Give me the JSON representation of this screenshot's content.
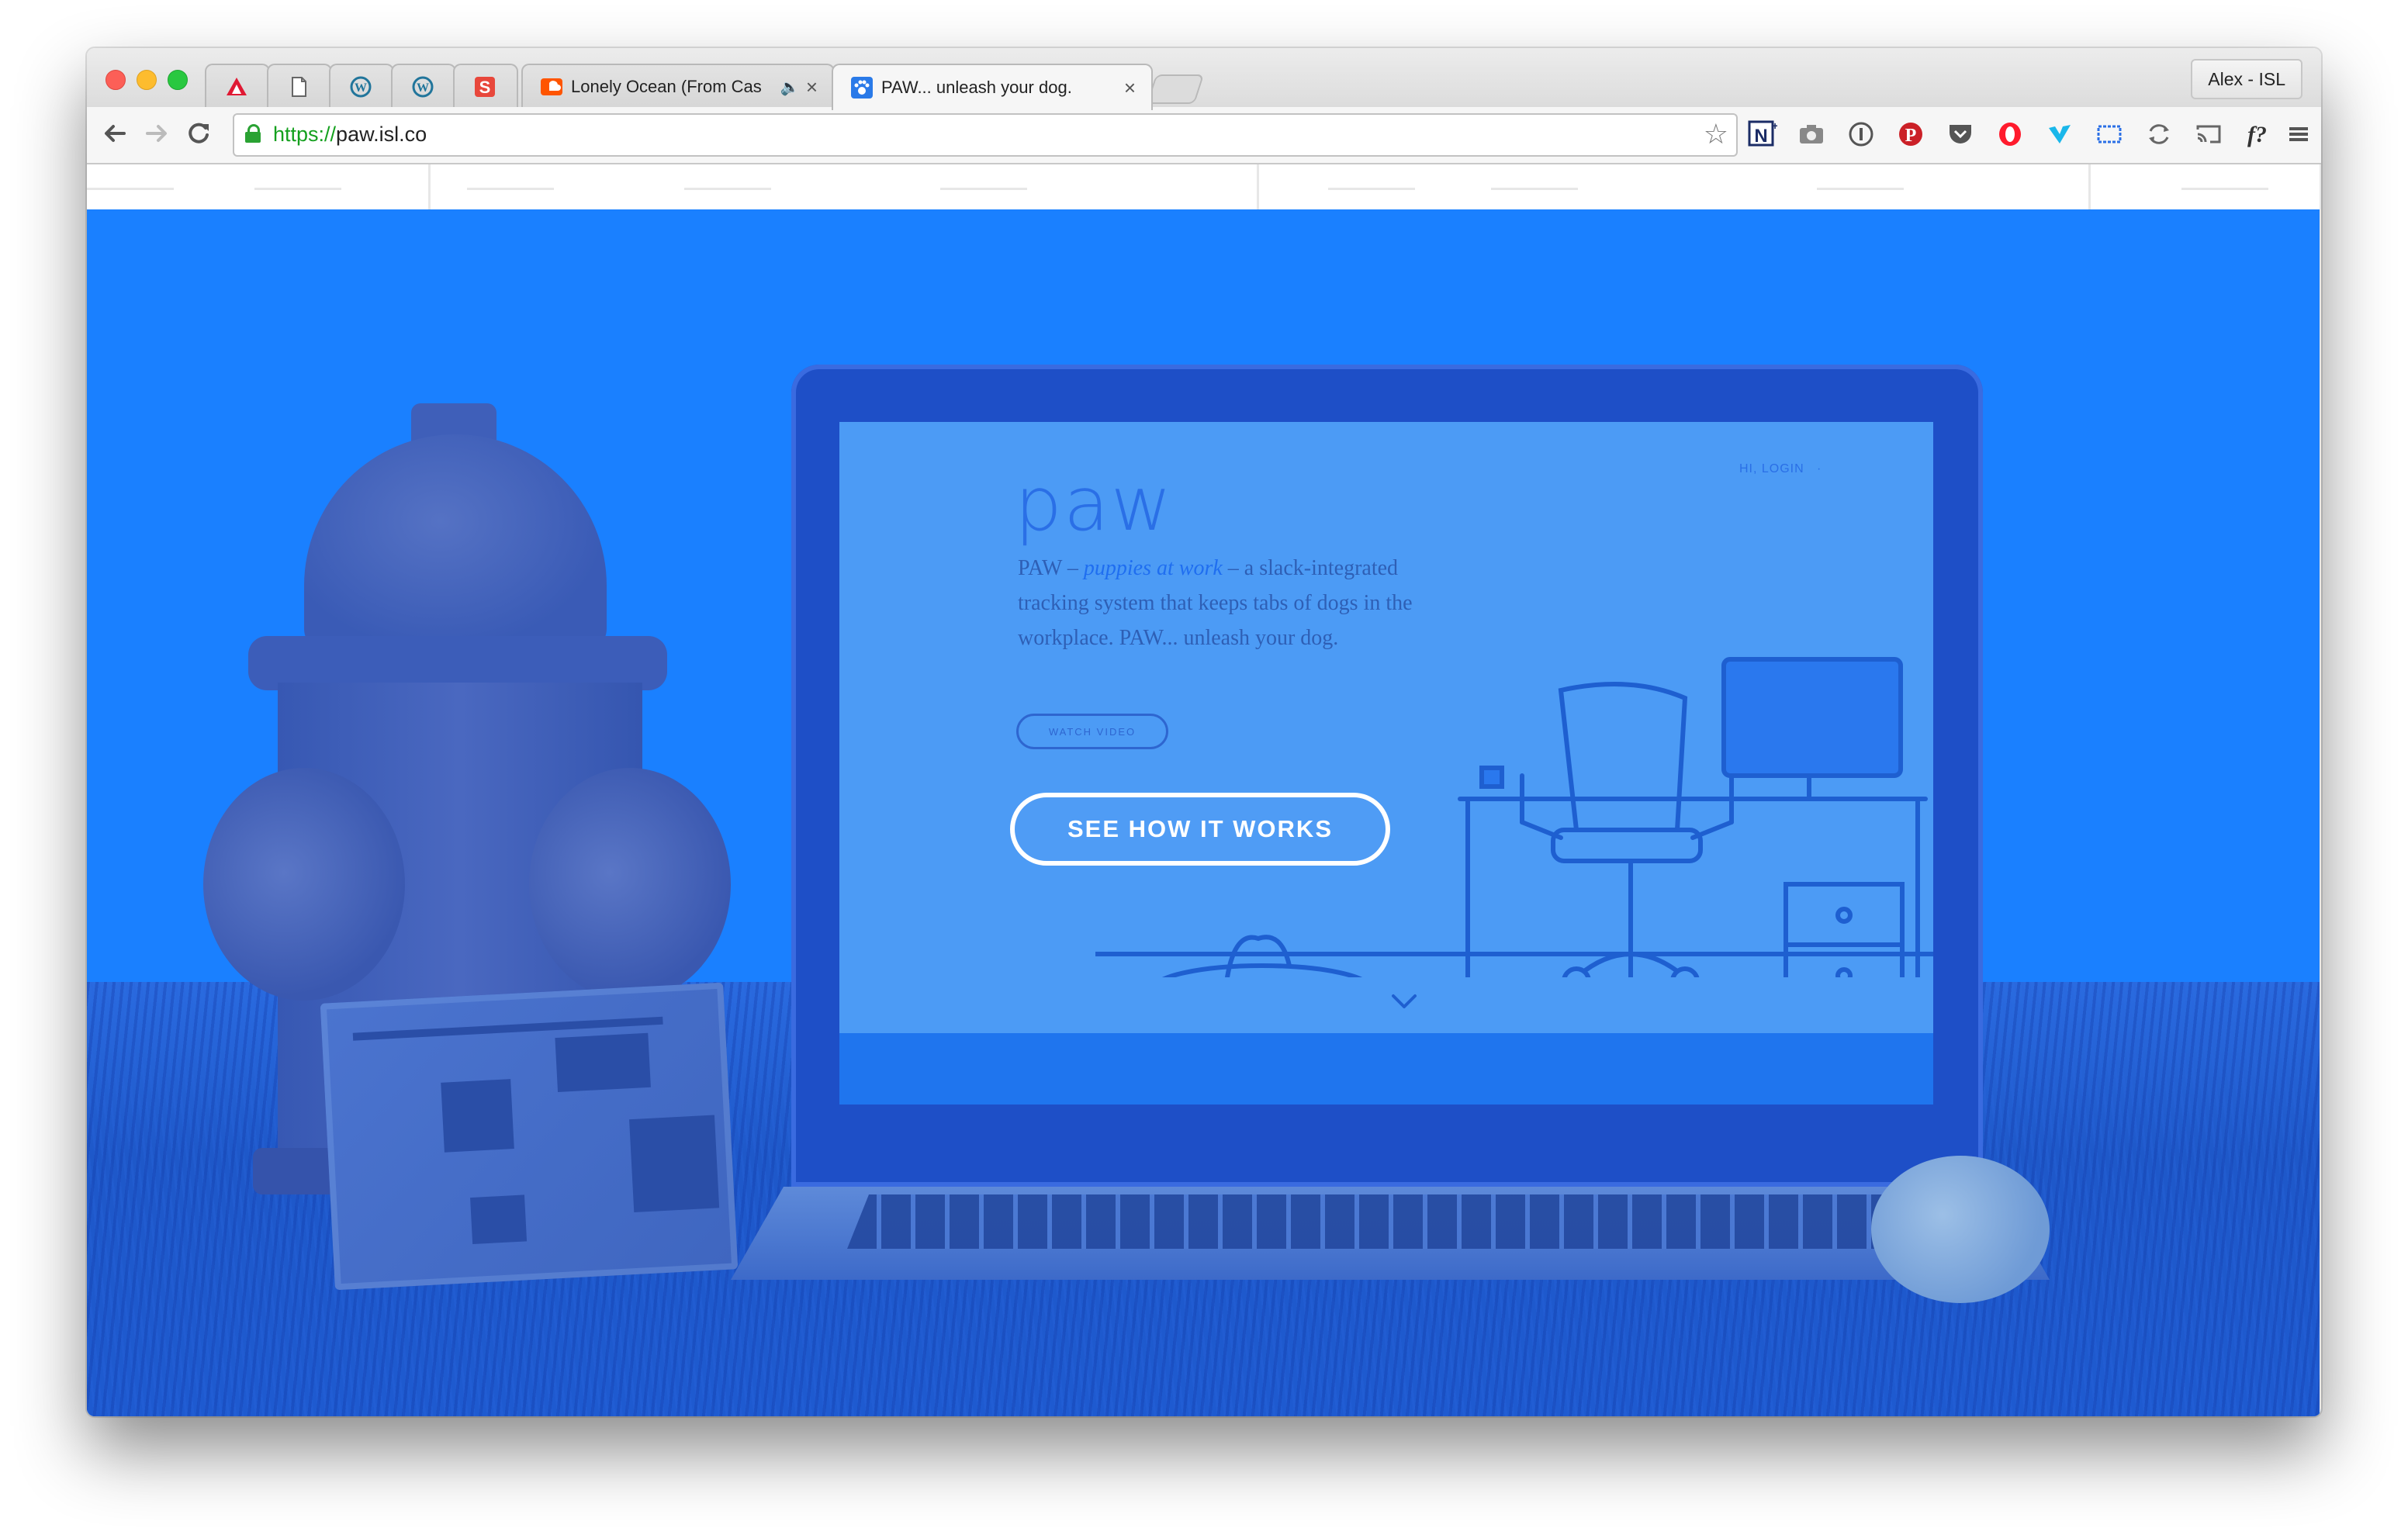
{
  "browser": {
    "tabs": [
      {
        "title": "",
        "favicon": "delta-icon",
        "favicon_color": "#e01933"
      },
      {
        "title": "",
        "favicon": "blank-page-icon",
        "favicon_color": "#777777"
      },
      {
        "title": "",
        "favicon": "wordpress-icon",
        "favicon_color": "#21759b"
      },
      {
        "title": "",
        "favicon": "wordpress-icon",
        "favicon_color": "#21759b"
      },
      {
        "title": "",
        "favicon": "s-app-icon",
        "favicon_color": "#e8473b"
      },
      {
        "title": "Lonely Ocean (From Cas",
        "favicon": "soundcloud-icon",
        "favicon_color": "#ff5500",
        "audio": true
      },
      {
        "title": "PAW... unleash your dog.",
        "favicon": "paw-icon",
        "favicon_color": "#2a7ae8",
        "active": true
      }
    ],
    "profile_name": "Alex - ISL",
    "address": {
      "scheme": "https://",
      "host": "paw.isl.co"
    },
    "extensions": [
      "notion-clipper-icon",
      "camera-icon",
      "1password-icon",
      "pinterest-icon",
      "pocket-icon",
      "opera-icon",
      "vimeo-icon",
      "screen-capture-icon",
      "sync-icon",
      "cast-icon",
      "fonts-icon",
      "menu-icon"
    ]
  },
  "page": {
    "hero": {
      "cta_label": "SEE HOW IT WORKS",
      "brand_color": "#1a80ff"
    },
    "screen": {
      "logo": "paw",
      "nav_text": "HI, LOGIN    · ",
      "copy_prefix": "PAW – ",
      "copy_emphasis": "puppies at work",
      "copy_suffix": " – a slack-integrated tracking system that keeps tabs of dogs in the workplace. PAW... unleash your dog.",
      "watch_video": "WATCH VIDEO"
    }
  }
}
